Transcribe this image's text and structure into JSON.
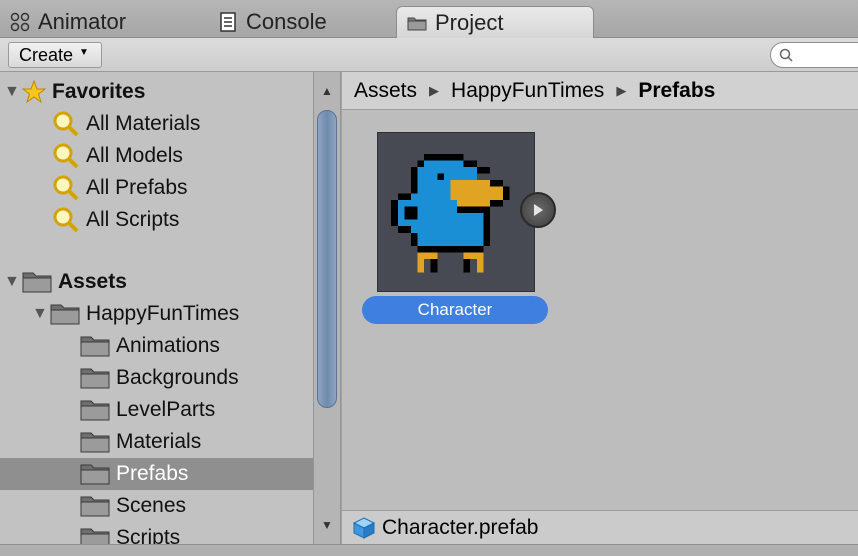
{
  "tabs": [
    {
      "label": "Animator",
      "icon": "animator-icon"
    },
    {
      "label": "Console",
      "icon": "console-icon"
    },
    {
      "label": "Project",
      "icon": "folder-icon",
      "active": true
    }
  ],
  "toolbar": {
    "create_label": "Create",
    "search_placeholder": ""
  },
  "tree": {
    "favorites_label": "Favorites",
    "favorites": [
      "All Materials",
      "All Models",
      "All Prefabs",
      "All Scripts"
    ],
    "assets_label": "Assets",
    "happy_label": "HappyFunTimes",
    "folders": [
      "Animations",
      "Backgrounds",
      "LevelParts",
      "Materials",
      "Prefabs",
      "Scenes",
      "Scripts"
    ],
    "selected": "Prefabs"
  },
  "breadcrumb": [
    "Assets",
    "HappyFunTimes",
    "Prefabs"
  ],
  "asset": {
    "name": "Character"
  },
  "status": {
    "filename": "Character.prefab"
  },
  "colors": {
    "selection": "#3f7fdf",
    "bird_blue": "#1a8fd6",
    "bird_yellow": "#e0a422",
    "thumb_bg": "#474a52"
  }
}
